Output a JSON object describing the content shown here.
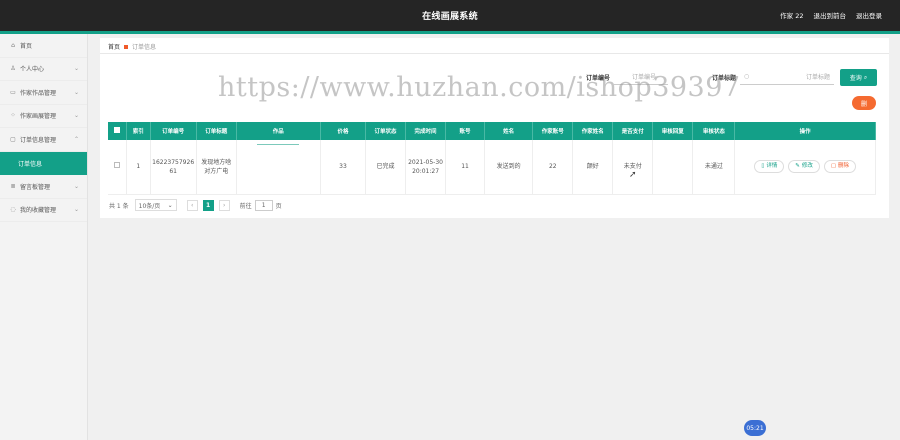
{
  "header": {
    "title": "在线画展系统",
    "user": "作家 22",
    "exit_backend": "退出到前台",
    "logout": "退出登录"
  },
  "sidebar": {
    "items": [
      {
        "icon": "home-icon",
        "glyph": "⌂",
        "label": "首页",
        "chevron": ""
      },
      {
        "icon": "user-icon",
        "glyph": "♙",
        "label": "个人中心",
        "chevron": "⌄"
      },
      {
        "icon": "chat-icon",
        "glyph": "▭",
        "label": "作家作品管理",
        "chevron": "⌄"
      },
      {
        "icon": "grid-icon",
        "glyph": "⁘",
        "label": "作家画展管理",
        "chevron": "⌄"
      },
      {
        "icon": "message-icon",
        "glyph": "▢",
        "label": "订单信息管理",
        "chevron": "⌃"
      },
      {
        "icon": "",
        "glyph": "",
        "label": "订单信息",
        "chevron": ""
      },
      {
        "icon": "list-icon",
        "glyph": "≣",
        "label": "留言板管理",
        "chevron": "⌄"
      },
      {
        "icon": "collect-icon",
        "glyph": "◌",
        "label": "我的收藏管理",
        "chevron": "⌄"
      }
    ]
  },
  "breadcrumb": {
    "home": "首页",
    "current": "订单信息"
  },
  "watermark": "https://www.huzhan.com/ishop39397",
  "search": {
    "order_no_label": "订单编号",
    "order_no_placeholder": "订单编号",
    "order_title_label": "订单标题",
    "order_title_placeholder": "订单标题",
    "search_button": "查询",
    "delete_button": "删"
  },
  "table": {
    "headers": [
      "索引",
      "订单编号",
      "订单标题",
      "作品",
      "价格",
      "订单状态",
      "完成时间",
      "账号",
      "姓名",
      "作家账号",
      "作家姓名",
      "是否支付",
      "审核回复",
      "审核状态",
      "操作"
    ],
    "row": {
      "index": "1",
      "order_no_1": "16223757926",
      "order_no_2": "61",
      "order_title_1": "发现地方啥",
      "order_title_2": "对方广电",
      "work": "",
      "price": "33",
      "status": "已完成",
      "finish_date": "2021-05-30",
      "finish_time": "20:01:27",
      "account": "11",
      "name": "发送到的",
      "author_account": "22",
      "author_name": "颠好",
      "paid": "未支付",
      "review_reply": "",
      "review_status": "未通过"
    },
    "ops": {
      "detail": "详情",
      "edit": "修改",
      "delete": "删除"
    }
  },
  "pagination": {
    "total": "共 1 条",
    "page_size": "10条/页",
    "current_page": "1",
    "goto_label": "前往",
    "goto_value": "1",
    "page_suffix": "页"
  },
  "clock": "05:21",
  "colors": {
    "primary": "#13a088",
    "topbar": "#252525",
    "danger": "#f56a30"
  }
}
